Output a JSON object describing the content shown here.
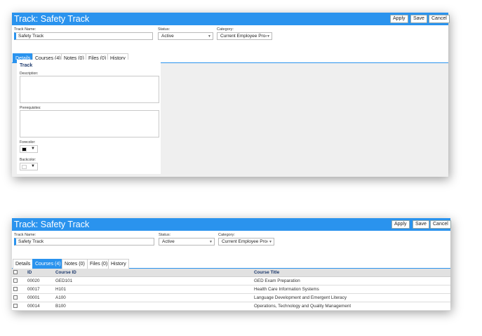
{
  "panels": [
    {
      "title": "Track: Safety Track",
      "buttons": {
        "apply": "Apply",
        "save": "Save",
        "cancel": "Cancel"
      },
      "fields": {
        "track_name_label": "Track Name:",
        "track_name_value": "Safety Track",
        "status_label": "Status:",
        "status_value": "Active",
        "category_label": "Category:",
        "category_value": "Current Employee Pro‹"
      },
      "tabs": [
        "Details",
        "Courses (4)",
        "Notes (0)",
        "Files (0)",
        "History"
      ],
      "active_tab": "Details",
      "details": {
        "section_title": "Track",
        "description_label": "Description:",
        "prerequisites_label": "Prerequisites:",
        "forecolor_label": "Forecolor:",
        "forecolor_value": "#000000",
        "backcolor_label": "Backcolor:",
        "backcolor_value": "#ffffff"
      }
    },
    {
      "title": "Track: Safety Track",
      "buttons": {
        "apply": "Apply",
        "save": "Save",
        "cancel": "Cancel"
      },
      "fields": {
        "track_name_label": "Track Name:",
        "track_name_value": "Safety Track",
        "status_label": "Status:",
        "status_value": "Active",
        "category_label": "Category:",
        "category_value": "Current Employee Pro‹"
      },
      "tabs": [
        "Details",
        "Courses (4)",
        "Notes (0)",
        "Files (0)",
        "History"
      ],
      "active_tab": "Courses (4)",
      "courses": {
        "columns": [
          "ID",
          "Course ID",
          "Course Title"
        ],
        "rows": [
          [
            "00020",
            "GED101",
            "GED Exam Preparation"
          ],
          [
            "00017",
            "H101",
            "Health Care Information Systems"
          ],
          [
            "00001",
            "A100",
            "Language Development and Emergent Literacy"
          ],
          [
            "00014",
            "B100",
            "Operations, Technology and Quality Management"
          ]
        ]
      }
    }
  ],
  "colors": {
    "accent": "#2a93ee",
    "header_text": "#1e3a6d"
  }
}
